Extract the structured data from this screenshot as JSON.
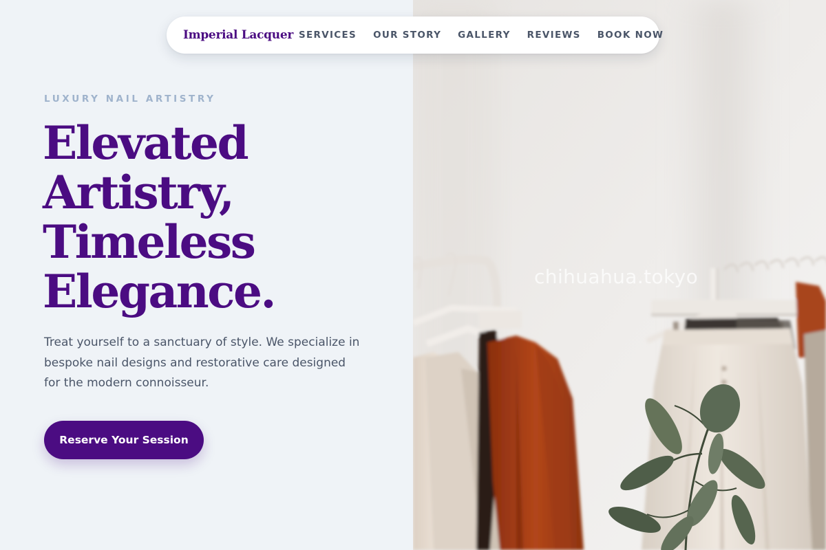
{
  "nav": {
    "brand": "Imperial Lacquer",
    "links": [
      "SERVICES",
      "OUR STORY",
      "GALLERY",
      "REVIEWS",
      "BOOK NOW"
    ]
  },
  "hero": {
    "eyebrow": "LUXURY NAIL ARTISTRY",
    "headline_lines": [
      "Elevated",
      "Artistry,",
      "Timeless",
      "Elegance."
    ],
    "subtext": "Treat yourself to a sanctuary of style. We specialize in bespoke nail designs and restorative care designed for the modern connoisseur.",
    "cta_label": "Reserve Your Session"
  },
  "image": {
    "subject": "clothing-rack-photo",
    "watermark": "chihuahua.tokyo"
  },
  "colors": {
    "brand": "#4b0c82",
    "background": "#eff3f7",
    "eyebrow": "#9fb3cc",
    "body_text": "#4a5568"
  }
}
